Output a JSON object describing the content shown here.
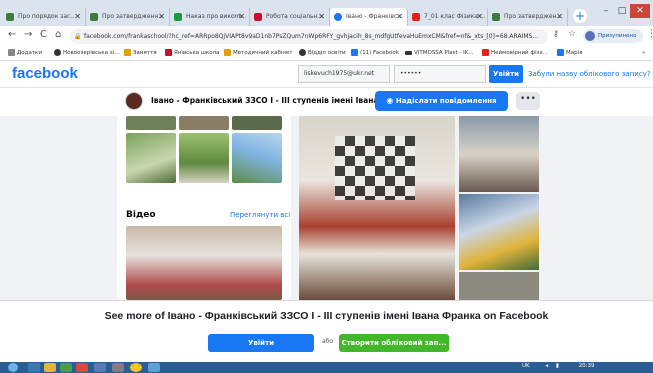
{
  "browser": {
    "tabs": [
      {
        "label": "Про порядок заr...",
        "color": "#3e7b3a"
      },
      {
        "label": "Про затвердженн...",
        "color": "#3e7b3a"
      },
      {
        "label": "Наказ про викоm...",
        "color": "#1a9c3c"
      },
      {
        "label": "Робота соціальн...",
        "color": "#c8102e"
      },
      {
        "label": "Івано - Франківс...",
        "color": "#1877f2"
      },
      {
        "label": "7_01 клас Фізика ...",
        "color": "#e62117"
      },
      {
        "label": "Про затверджен...",
        "color": "#3e7b3a"
      }
    ],
    "new_tab": "+",
    "window_min": "–",
    "window_max": "□",
    "window_close": "✕",
    "url": "facebook.com/frankaschool/?hc_ref=ARRpo8QjVIAPt8v9aD1nb7PsZQum7nWp6RFY_gvhjacih_8s_mdfgUtfevaHuEmxCM&fref=nf&_xts_[0]=68.ARAIMS...",
    "profile_label": "Призупинено",
    "back": "←",
    "forward": "→",
    "reload": "C",
    "home": "⌂",
    "bookmarks": [
      {
        "label": "Додатки",
        "color": "#888"
      },
      {
        "label": "Новоозерівська зі...",
        "color": "#333"
      },
      {
        "label": "Заняття",
        "color": "#e0a000"
      },
      {
        "label": "Янівська школа",
        "color": "#c8102e"
      },
      {
        "label": "Методичний кабінет",
        "color": "#e0a000"
      },
      {
        "label": "Відділ освіти",
        "color": "#333"
      },
      {
        "label": "(11) Facebook",
        "color": "#1877f2"
      },
      {
        "label": "VITMOSSA Plast - IK...",
        "color": "#333"
      },
      {
        "label": "Неймовірний фізх...",
        "color": "#e62117"
      },
      {
        "label": "Марія",
        "color": "#1877f2"
      }
    ],
    "bookmarks_more": "»"
  },
  "fb": {
    "logo": "facebook",
    "email_value": "liskevuch1975@ukr.net",
    "password_value": "••••••",
    "login_button": "Увійти",
    "forgot_link": "Забули назву облікового запису?"
  },
  "page": {
    "title": "Івано - Франківський ЗЗСО I - III ступенів імені Івана ...",
    "message_button": "Надіслати повідомлення",
    "more_button": "•••",
    "video_section_title": "Відео",
    "video_see_all": "Переглянути всі"
  },
  "overlay": {
    "see_more": "See more of Івано - Франківський ЗЗСО I - III ступенів імені Івана Франка on Facebook",
    "login_button": "Увійти",
    "or_text": "або",
    "create_button": "Створити обліковий зап..."
  },
  "taskbar": {
    "lang": "UK",
    "time": "20:39"
  }
}
